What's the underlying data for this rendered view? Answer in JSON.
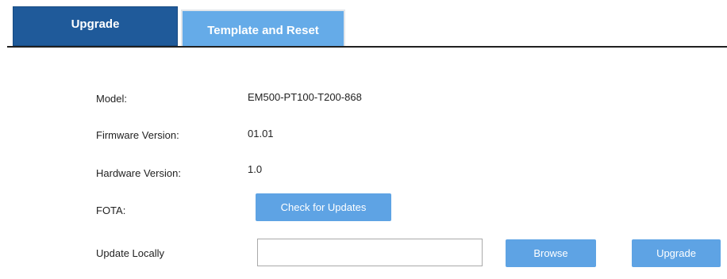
{
  "tabs": {
    "upgrade": "Upgrade",
    "template_reset": "Template and Reset"
  },
  "form": {
    "model_label": "Model:",
    "model_value": "EM500-PT100-T200-868",
    "firmware_label": "Firmware Version:",
    "firmware_value": "01.01",
    "hardware_label": "Hardware Version:",
    "hardware_value": "1.0",
    "fota_label": "FOTA:",
    "check_updates_button": "Check for Updates",
    "update_locally_label": "Update Locally",
    "update_locally_value": "",
    "browse_button": "Browse",
    "upgrade_button": "Upgrade"
  },
  "colors": {
    "active_tab": "#1f5a9a",
    "inactive_tab": "#65abe8",
    "button": "#5ea3e4"
  }
}
